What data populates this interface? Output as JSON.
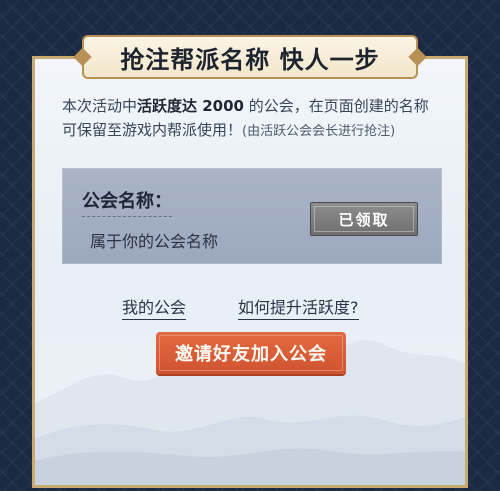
{
  "title": "抢注帮派名称 快人一步",
  "intro": {
    "part1": "本次活动中",
    "highlight": "活跃度达 2000",
    "part2": " 的公会，在页面创建的名称可保留至游戏内帮派使用！",
    "note": "(由活跃公会会长进行抢注)"
  },
  "guild": {
    "label": "公会名称：",
    "name": "属于你的公会名称",
    "button": "已领取"
  },
  "links": {
    "my_guild": "我的公会",
    "raise_activity": "如何提升活跃度?"
  },
  "invite_button": "邀请好友加入公会"
}
